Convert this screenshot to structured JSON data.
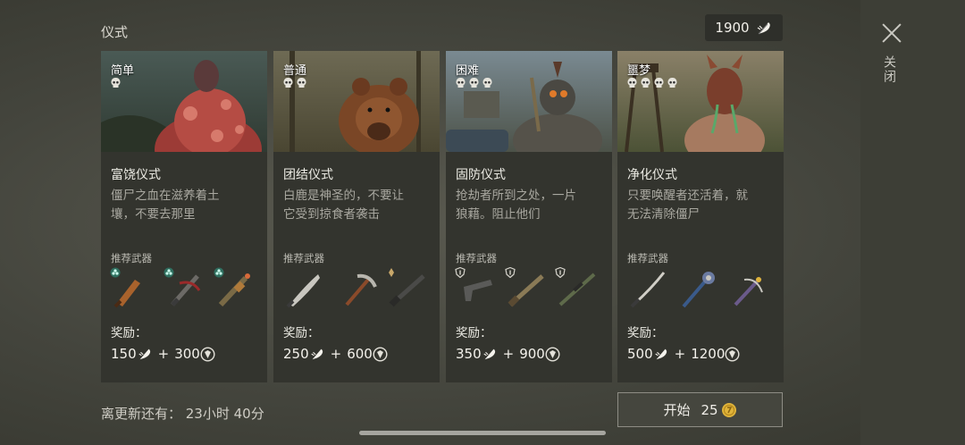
{
  "header": {
    "title": "仪式",
    "currency_amount": "1900",
    "currency_icon": "feather-icon"
  },
  "close": {
    "label": "关闭"
  },
  "cards": [
    {
      "difficulty": "简单",
      "skull_count": 1,
      "name": "富饶仪式",
      "desc_line1": "僵尸之血在滋养着土",
      "desc_line2": "壤，不要去那里",
      "weapons_label": "推荐武器",
      "reward_label": "奖励：",
      "reward_feathers": "150",
      "plus": "+",
      "reward_xp": "300",
      "art_theme": "blob-monster",
      "weapon_badge": "green-clover"
    },
    {
      "difficulty": "普通",
      "skull_count": 2,
      "name": "团结仪式",
      "desc_line1": "白鹿是神圣的，不要让",
      "desc_line2": "它受到掠食者袭击",
      "weapons_label": "推荐武器",
      "reward_label": "奖励：",
      "reward_feathers": "250",
      "plus": "+",
      "reward_xp": "600",
      "art_theme": "bear",
      "weapon_badge": "leaf"
    },
    {
      "difficulty": "困难",
      "skull_count": 3,
      "name": "固防仪式",
      "desc_line1": "抢劫者所到之处，一片",
      "desc_line2": "狼藉。阻止他们",
      "weapons_label": "推荐武器",
      "reward_label": "奖励：",
      "reward_feathers": "350",
      "plus": "+",
      "reward_xp": "900",
      "art_theme": "raider",
      "weapon_badge": "shield"
    },
    {
      "difficulty": "噩梦",
      "skull_count": 4,
      "name": "净化仪式",
      "desc_line1": "只要唤醒者还活着，就",
      "desc_line2": "无法清除僵尸",
      "weapons_label": "推荐武器",
      "reward_label": "奖励：",
      "reward_feathers": "500",
      "plus": "+",
      "reward_xp": "1200",
      "art_theme": "awakener",
      "weapon_badge": "none"
    }
  ],
  "footer": {
    "refresh_text": "离更新还有：  23小时 40分",
    "start_label": "开始",
    "start_cost": "25",
    "start_cost_icon": "gold-coin-icon"
  },
  "colors": {
    "card_bg": "#33342e",
    "accent_gold": "#e0b43a",
    "text_main": "#ecebe4"
  }
}
